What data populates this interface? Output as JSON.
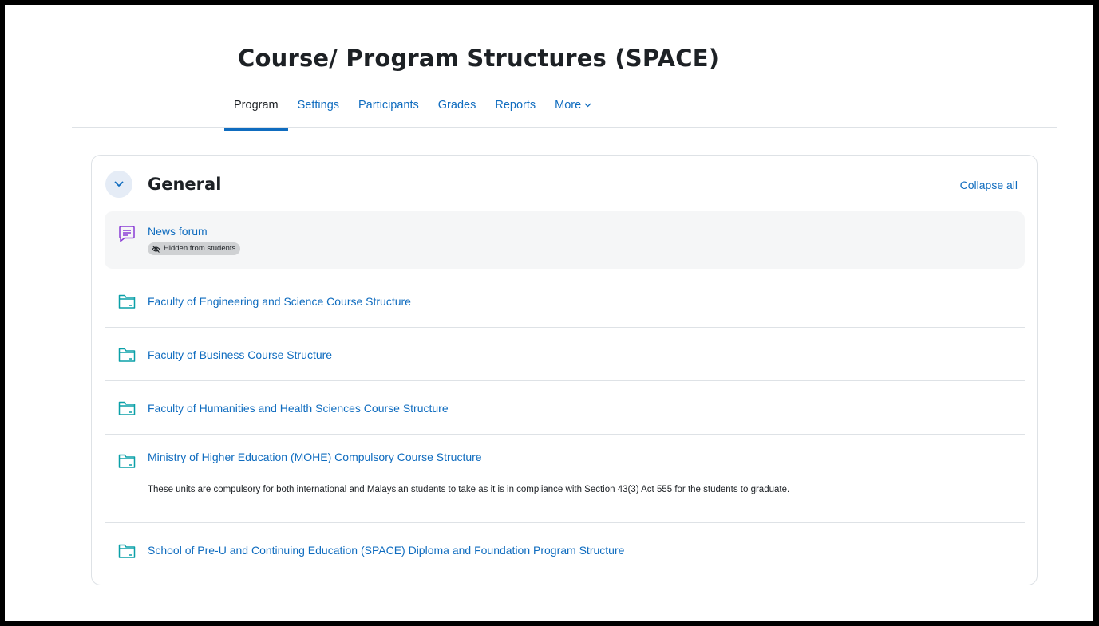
{
  "page": {
    "title": "Course/ Program Structures (SPACE)"
  },
  "nav": {
    "tabs": [
      {
        "label": "Program",
        "active": true
      },
      {
        "label": "Settings"
      },
      {
        "label": "Participants"
      },
      {
        "label": "Grades"
      },
      {
        "label": "Reports"
      },
      {
        "label": "More"
      }
    ]
  },
  "section": {
    "title": "General",
    "collapse_label": "Collapse all",
    "activities": [
      {
        "name": "News forum",
        "icon": "forum-icon",
        "badge": "Hidden from students"
      },
      {
        "name": "Faculty of Engineering and Science Course Structure",
        "icon": "folder-icon"
      },
      {
        "name": "Faculty of Business Course Structure",
        "icon": "folder-icon"
      },
      {
        "name": "Faculty of Humanities and Health Sciences Course Structure",
        "icon": "folder-icon"
      },
      {
        "name": "Ministry of Higher Education (MOHE) Compulsory Course Structure",
        "icon": "folder-icon",
        "description": "These units are compulsory for both international and Malaysian students to take as it is in compliance with Section 43(3) Act 555 for the students to graduate."
      },
      {
        "name": "School of Pre-U and Continuing Education (SPACE) Diploma and Foundation Program Structure",
        "icon": "folder-icon"
      }
    ]
  },
  "colors": {
    "link": "#0f6cbf",
    "forum_icon": "#8a3cd6",
    "folder_icon": "#0aa0a8",
    "text": "#1d2125"
  }
}
